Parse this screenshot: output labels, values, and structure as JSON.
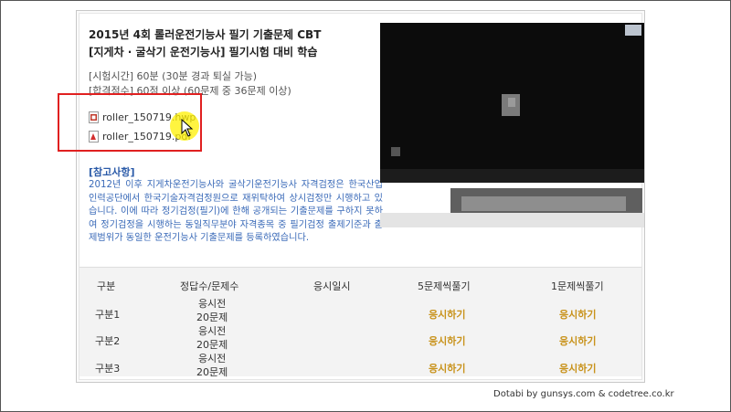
{
  "header": {
    "title_line1": "2015년 4회 롤러운전기능사 필기 기출문제 CBT",
    "title_line2": "[지게차 · 굴삭기 운전기능사] 필기시험 대비 학습"
  },
  "info": {
    "time": "[시험시간] 60분 (30분 경과 퇴실 가능)",
    "pass": "[합격점수] 60점 이상 (60문제 중 36문제 이상)"
  },
  "files": [
    {
      "name": "roller_150719.hwp",
      "icon": "hwp-file-icon"
    },
    {
      "name": "roller_150719.pdf",
      "icon": "pdf-file-icon"
    }
  ],
  "reference": {
    "title": "[참고사항]",
    "body": "2012년 이후 지게차운전기능사와 굴삭기운전기능사 자격검정은 한국산업인력공단에서 한국기술자격검정원으로 재위탁하여 상시검정만 시행하고 있습니다. 이에 따라 정기검정(필기)에 한해 공개되는 기출문제를 구하지 못하여 정기검정을 시행하는 동일직무분야 자격종목 중 필기검정 출제기준과 출제범위가 동일한 운전기능사 기출문제를 등록하였습니다."
  },
  "table": {
    "headers": [
      "구분",
      "정답수/문제수",
      "응시일시",
      "5문제씩풀기",
      "1문제씩풀기"
    ],
    "rows": [
      {
        "label": "구분1",
        "status": "응시전",
        "count": "20문제",
        "five": "응시하기",
        "one": "응시하기"
      },
      {
        "label": "구분2",
        "status": "응시전",
        "count": "20문제",
        "five": "응시하기",
        "one": "응시하기"
      },
      {
        "label": "구분3",
        "status": "응시전",
        "count": "20문제",
        "five": "응시하기",
        "one": "응시하기"
      }
    ]
  },
  "footer": "Dotabi by gunsys.com & codetree.co.kr",
  "colors": {
    "accent_link": "#c8921a",
    "ref_text": "#3a6ab8",
    "highlight_box": "#e02020"
  }
}
